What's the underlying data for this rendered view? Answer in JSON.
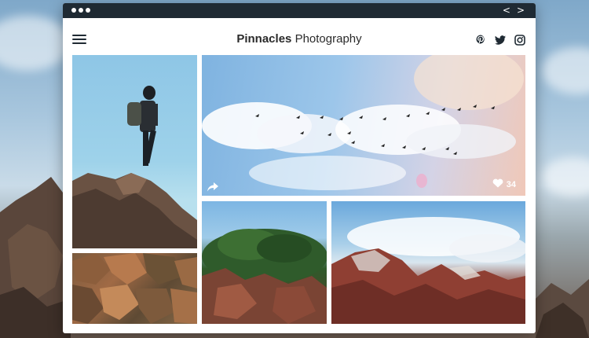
{
  "brand": {
    "name_bold": "Pinnacles",
    "name_light": "Photography"
  },
  "icons": {
    "menu": "hamburger-icon",
    "social": [
      "pinterest-icon",
      "twitter-icon",
      "instagram-icon"
    ],
    "window_nav": [
      "chevron-left-icon",
      "chevron-right-icon"
    ],
    "share": "share-icon",
    "like": "heart-icon"
  },
  "window_nav": {
    "back": "<",
    "forward": ">"
  },
  "gallery": {
    "featured": {
      "likes": "34"
    }
  },
  "colors": {
    "titlebar": "#1f2a33",
    "text": "#2a2a2a"
  }
}
